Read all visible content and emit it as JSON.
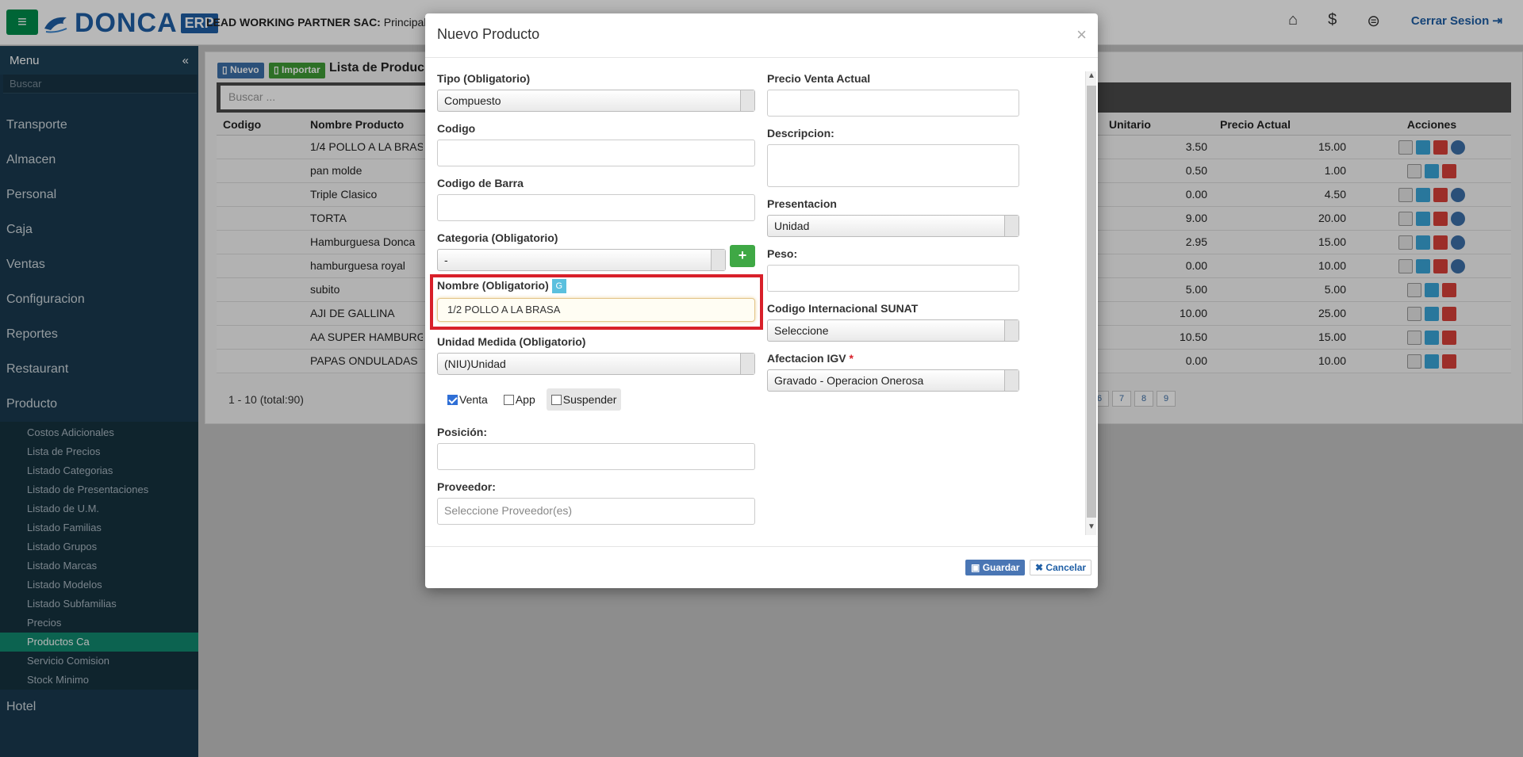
{
  "topbar": {
    "logo_text": "DONCA",
    "logo_badge": "ERP",
    "company_prefix": "LEAD WORKING PARTNER SAC:",
    "company_branch": "Principal",
    "logout_label": "Cerrar Sesion"
  },
  "sidebar": {
    "menu_label": "Menu",
    "collapse_glyph": "«",
    "search_placeholder": "Buscar",
    "items": [
      "Transporte",
      "Almacen",
      "Personal",
      "Caja",
      "Ventas",
      "Configuracion",
      "Reportes",
      "Restaurant",
      "Producto"
    ],
    "subitems": [
      "Costos Adicionales",
      "Lista de Precios",
      "Listado Categorias",
      "Listado de Presentaciones",
      "Listado de U.M.",
      "Listado Familias",
      "Listado Grupos",
      "Listado Marcas",
      "Listado Modelos",
      "Listado Subfamilias",
      "Precios",
      "Productos Ca",
      "Servicio Comision",
      "Stock Minimo"
    ],
    "active_subitem": "Productos Ca",
    "last_item": "Hotel"
  },
  "main": {
    "btn_nuevo": "Nuevo",
    "btn_importar": "Importar",
    "title": "Lista de Produc",
    "search_placeholder": "Buscar ...",
    "headers": [
      "Codigo",
      "Nombre Producto",
      "Unitario",
      "Precio Actual",
      "Acciones"
    ],
    "rows": [
      {
        "name": "1/4 POLLO A LA BRAS",
        "unit": "3.50",
        "price": "15.00"
      },
      {
        "name": "pan molde",
        "unit": "0.50",
        "price": "1.00"
      },
      {
        "name": "Triple Clasico",
        "unit": "0.00",
        "price": "4.50"
      },
      {
        "name": "TORTA",
        "unit": "9.00",
        "price": "20.00"
      },
      {
        "name": "Hamburguesa Donca",
        "unit": "2.95",
        "price": "15.00"
      },
      {
        "name": "hamburguesa royal",
        "unit": "0.00",
        "price": "10.00"
      },
      {
        "name": "subito",
        "unit": "5.00",
        "price": "5.00"
      },
      {
        "name": "AJI DE GALLINA",
        "unit": "10.00",
        "price": "25.00"
      },
      {
        "name": "AA SUPER HAMBURG",
        "unit": "10.50",
        "price": "15.00"
      },
      {
        "name": "PAPAS ONDULADAS",
        "unit": "0.00",
        "price": "10.00"
      }
    ],
    "pagination_text": "1 - 10 (total:90)",
    "pages": [
      "6",
      "7",
      "8",
      "9"
    ]
  },
  "modal": {
    "title": "Nuevo Producto",
    "close": "×",
    "tipo_label": "Tipo (Obligatorio)",
    "tipo_value": "Compuesto",
    "codigo_label": "Codigo",
    "barra_label": "Codigo de Barra",
    "categoria_label": "Categoria (Obligatorio)",
    "categoria_value": "-",
    "plus": "+",
    "nombre_label": "Nombre (Obligatorio)",
    "nombre_badge": "G",
    "nombre_value": "1/2 POLLO A LA BRASA",
    "unidad_label": "Unidad Medida (Obligatorio)",
    "unidad_value": "(NIU)Unidad",
    "cb_venta": "Venta",
    "cb_app": "App",
    "cb_suspender": "Suspender",
    "posicion_label": "Posición:",
    "proveedor_label": "Proveedor:",
    "proveedor_placeholder": "Seleccione Proveedor(es)",
    "precio_label": "Precio Venta Actual",
    "descripcion_label": "Descripcion:",
    "presentacion_label": "Presentacion",
    "presentacion_value": "Unidad",
    "peso_label": "Peso:",
    "sunat_label": "Codigo Internacional SUNAT",
    "sunat_value": "Seleccione",
    "igv_label": "Afectacion IGV",
    "igv_required": "*",
    "igv_value": "Gravado - Operacion Onerosa",
    "btn_guardar": "Guardar",
    "btn_cancelar": "Cancelar"
  }
}
